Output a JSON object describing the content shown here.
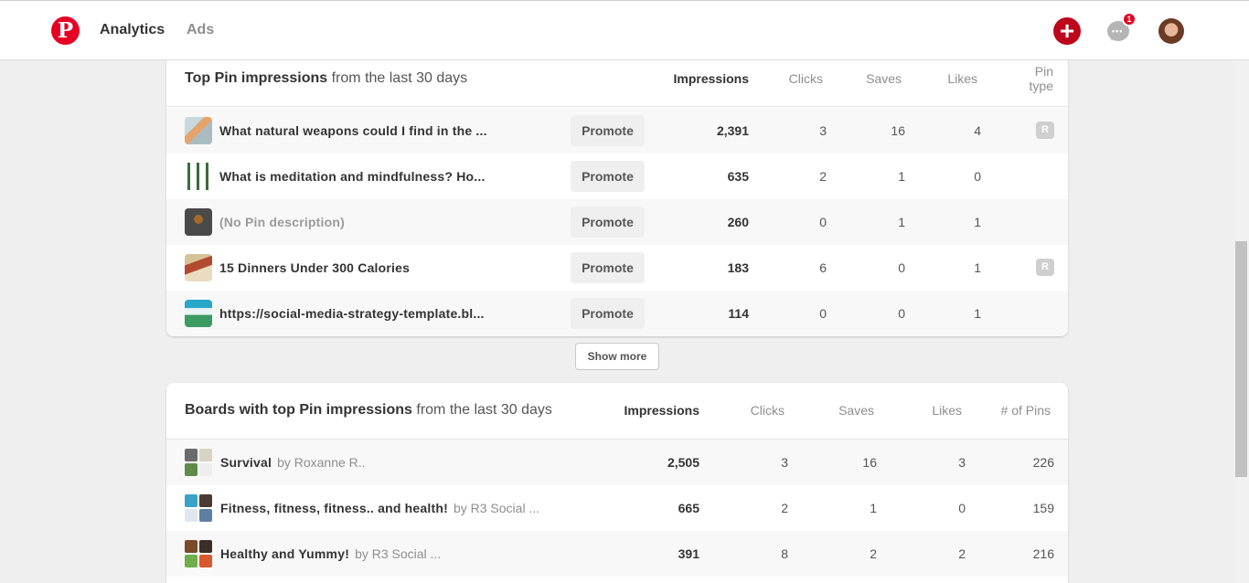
{
  "nav": {
    "analytics": "Analytics",
    "ads": "Ads"
  },
  "header": {
    "create_symbol": "+",
    "messages_badge": "1",
    "logo_letter": "P"
  },
  "top_pins": {
    "title_bold": "Top Pin impressions",
    "title_rest": " from the last 30 days",
    "columns": {
      "impressions": "Impressions",
      "clicks": "Clicks",
      "saves": "Saves",
      "likes": "Likes",
      "pin_type_line1": "Pin",
      "pin_type_line2": "type"
    },
    "promote_label": "Promote",
    "rows": [
      {
        "title": "What natural weapons could I find in the ...",
        "impressions": "2,391",
        "clicks": "3",
        "saves": "16",
        "likes": "4",
        "type": "R"
      },
      {
        "title": "What is meditation and mindfulness? Ho...",
        "impressions": "635",
        "clicks": "2",
        "saves": "1",
        "likes": "0",
        "type": ""
      },
      {
        "title": "(No Pin description)",
        "impressions": "260",
        "clicks": "0",
        "saves": "1",
        "likes": "1",
        "type": ""
      },
      {
        "title": "15 Dinners Under 300 Calories",
        "impressions": "183",
        "clicks": "6",
        "saves": "0",
        "likes": "1",
        "type": "R"
      },
      {
        "title": "https://social-media-strategy-template.bl...",
        "impressions": "114",
        "clicks": "0",
        "saves": "0",
        "likes": "1",
        "type": ""
      }
    ],
    "show_more": "Show more"
  },
  "top_boards": {
    "title_bold": "Boards with top Pin impressions",
    "title_rest": " from the last 30 days",
    "columns": {
      "impressions": "Impressions",
      "clicks": "Clicks",
      "saves": "Saves",
      "likes": "Likes",
      "pins": "# of Pins"
    },
    "rows": [
      {
        "name": "Survival",
        "owner": "by Roxanne R..",
        "impressions": "2,505",
        "clicks": "3",
        "saves": "16",
        "likes": "3",
        "pins": "226"
      },
      {
        "name": "Fitness, fitness, fitness.. and health!",
        "owner": "by R3 Social ...",
        "impressions": "665",
        "clicks": "2",
        "saves": "1",
        "likes": "0",
        "pins": "159"
      },
      {
        "name": "Healthy and Yummy!",
        "owner": "by R3 Social ...",
        "impressions": "391",
        "clicks": "8",
        "saves": "2",
        "likes": "2",
        "pins": "216"
      }
    ]
  },
  "colors": {
    "brand": "#e60023",
    "create": "#bd081c"
  }
}
